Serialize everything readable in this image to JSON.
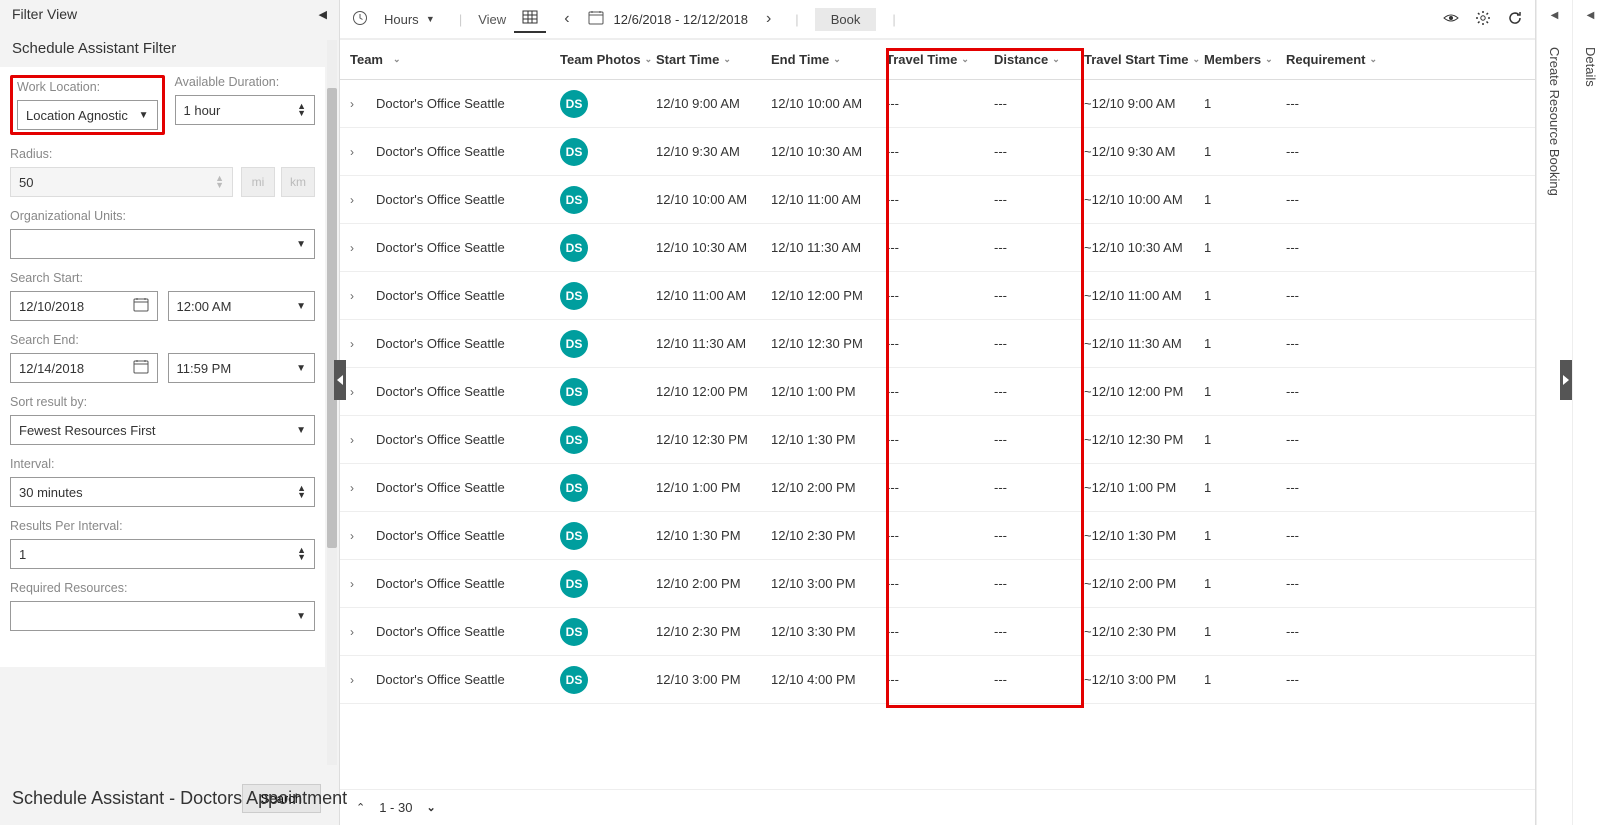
{
  "filter": {
    "panel_title": "Filter View",
    "section_title": "Schedule Assistant Filter",
    "work_location": {
      "label": "Work Location:",
      "value": "Location Agnostic"
    },
    "available_duration": {
      "label": "Available Duration:",
      "value": "1 hour"
    },
    "radius": {
      "label": "Radius:",
      "value": "50",
      "unit_mi": "mi",
      "unit_km": "km"
    },
    "org_units": {
      "label": "Organizational Units:",
      "value": ""
    },
    "search_start": {
      "label": "Search Start:",
      "date": "12/10/2018",
      "time": "12:00 AM"
    },
    "search_end": {
      "label": "Search End:",
      "date": "12/14/2018",
      "time": "11:59 PM"
    },
    "sort": {
      "label": "Sort result by:",
      "value": "Fewest Resources First"
    },
    "interval": {
      "label": "Interval:",
      "value": "30 minutes"
    },
    "results_per_interval": {
      "label": "Results Per Interval:",
      "value": "1"
    },
    "required_resources": {
      "label": "Required Resources:",
      "value": ""
    },
    "search_button": "Search"
  },
  "toolbar": {
    "hours": "Hours",
    "view": "View",
    "date_range": "12/6/2018 - 12/12/2018",
    "book": "Book"
  },
  "columns": [
    "Team",
    "Team Photos",
    "Start Time",
    "End Time",
    "Travel Time",
    "Distance",
    "Travel Start Time",
    "Members",
    "Requirement"
  ],
  "rows": [
    {
      "team": "Doctor's Office Seattle",
      "initials": "DS",
      "start": "12/10 9:00 AM",
      "end": "12/10 10:00 AM",
      "travel": "---",
      "dist": "---",
      "tstart": "~12/10 9:00 AM",
      "members": "1",
      "req": "---"
    },
    {
      "team": "Doctor's Office Seattle",
      "initials": "DS",
      "start": "12/10 9:30 AM",
      "end": "12/10 10:30 AM",
      "travel": "---",
      "dist": "---",
      "tstart": "~12/10 9:30 AM",
      "members": "1",
      "req": "---"
    },
    {
      "team": "Doctor's Office Seattle",
      "initials": "DS",
      "start": "12/10 10:00 AM",
      "end": "12/10 11:00 AM",
      "travel": "---",
      "dist": "---",
      "tstart": "~12/10 10:00 AM",
      "members": "1",
      "req": "---"
    },
    {
      "team": "Doctor's Office Seattle",
      "initials": "DS",
      "start": "12/10 10:30 AM",
      "end": "12/10 11:30 AM",
      "travel": "---",
      "dist": "---",
      "tstart": "~12/10 10:30 AM",
      "members": "1",
      "req": "---"
    },
    {
      "team": "Doctor's Office Seattle",
      "initials": "DS",
      "start": "12/10 11:00 AM",
      "end": "12/10 12:00 PM",
      "travel": "---",
      "dist": "---",
      "tstart": "~12/10 11:00 AM",
      "members": "1",
      "req": "---"
    },
    {
      "team": "Doctor's Office Seattle",
      "initials": "DS",
      "start": "12/10 11:30 AM",
      "end": "12/10 12:30 PM",
      "travel": "---",
      "dist": "---",
      "tstart": "~12/10 11:30 AM",
      "members": "1",
      "req": "---"
    },
    {
      "team": "Doctor's Office Seattle",
      "initials": "DS",
      "start": "12/10 12:00 PM",
      "end": "12/10 1:00 PM",
      "travel": "---",
      "dist": "---",
      "tstart": "~12/10 12:00 PM",
      "members": "1",
      "req": "---"
    },
    {
      "team": "Doctor's Office Seattle",
      "initials": "DS",
      "start": "12/10 12:30 PM",
      "end": "12/10 1:30 PM",
      "travel": "---",
      "dist": "---",
      "tstart": "~12/10 12:30 PM",
      "members": "1",
      "req": "---"
    },
    {
      "team": "Doctor's Office Seattle",
      "initials": "DS",
      "start": "12/10 1:00 PM",
      "end": "12/10 2:00 PM",
      "travel": "---",
      "dist": "---",
      "tstart": "~12/10 1:00 PM",
      "members": "1",
      "req": "---"
    },
    {
      "team": "Doctor's Office Seattle",
      "initials": "DS",
      "start": "12/10 1:30 PM",
      "end": "12/10 2:30 PM",
      "travel": "---",
      "dist": "---",
      "tstart": "~12/10 1:30 PM",
      "members": "1",
      "req": "---"
    },
    {
      "team": "Doctor's Office Seattle",
      "initials": "DS",
      "start": "12/10 2:00 PM",
      "end": "12/10 3:00 PM",
      "travel": "---",
      "dist": "---",
      "tstart": "~12/10 2:00 PM",
      "members": "1",
      "req": "---"
    },
    {
      "team": "Doctor's Office Seattle",
      "initials": "DS",
      "start": "12/10 2:30 PM",
      "end": "12/10 3:30 PM",
      "travel": "---",
      "dist": "---",
      "tstart": "~12/10 2:30 PM",
      "members": "1",
      "req": "---"
    },
    {
      "team": "Doctor's Office Seattle",
      "initials": "DS",
      "start": "12/10 3:00 PM",
      "end": "12/10 4:00 PM",
      "travel": "---",
      "dist": "---",
      "tstart": "~12/10 3:00 PM",
      "members": "1",
      "req": "---"
    }
  ],
  "footer": {
    "range": "1 - 30"
  },
  "right_rail": {
    "details": "Details",
    "create": "Create Resource Booking"
  },
  "bottom_title": "Schedule Assistant - Doctors Appointment"
}
